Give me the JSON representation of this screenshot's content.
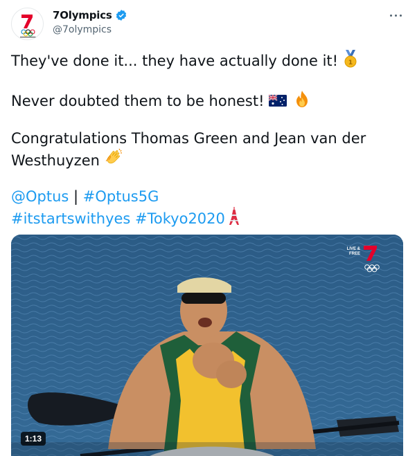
{
  "account": {
    "display_name": "7Olympics",
    "handle": "@7olympics",
    "verified": true
  },
  "tweet": {
    "line1": "They've done it... they have actually done it!",
    "line2": "Never doubted them to be honest!",
    "line3": "Congratulations Thomas Green and Jean van der",
    "line4": "Westhuyzen",
    "mention": "@Optus",
    "separator": "|",
    "hashtag1": "#Optus5G",
    "hashtag2": "#itstartswithyes",
    "hashtag3": "#Tokyo2020"
  },
  "emojis": [
    "gold-medal",
    "australia-flag",
    "fire",
    "clapping-hands",
    "tokyo-tower"
  ],
  "media": {
    "duration": "1:13",
    "broadcaster_live_label": "LIVE & FREE"
  },
  "colors": {
    "link": "#1d9bf0",
    "text": "#0f1419",
    "secondary": "#536471",
    "verified": "#1d9bf0",
    "brand_red": "#e4002b"
  }
}
